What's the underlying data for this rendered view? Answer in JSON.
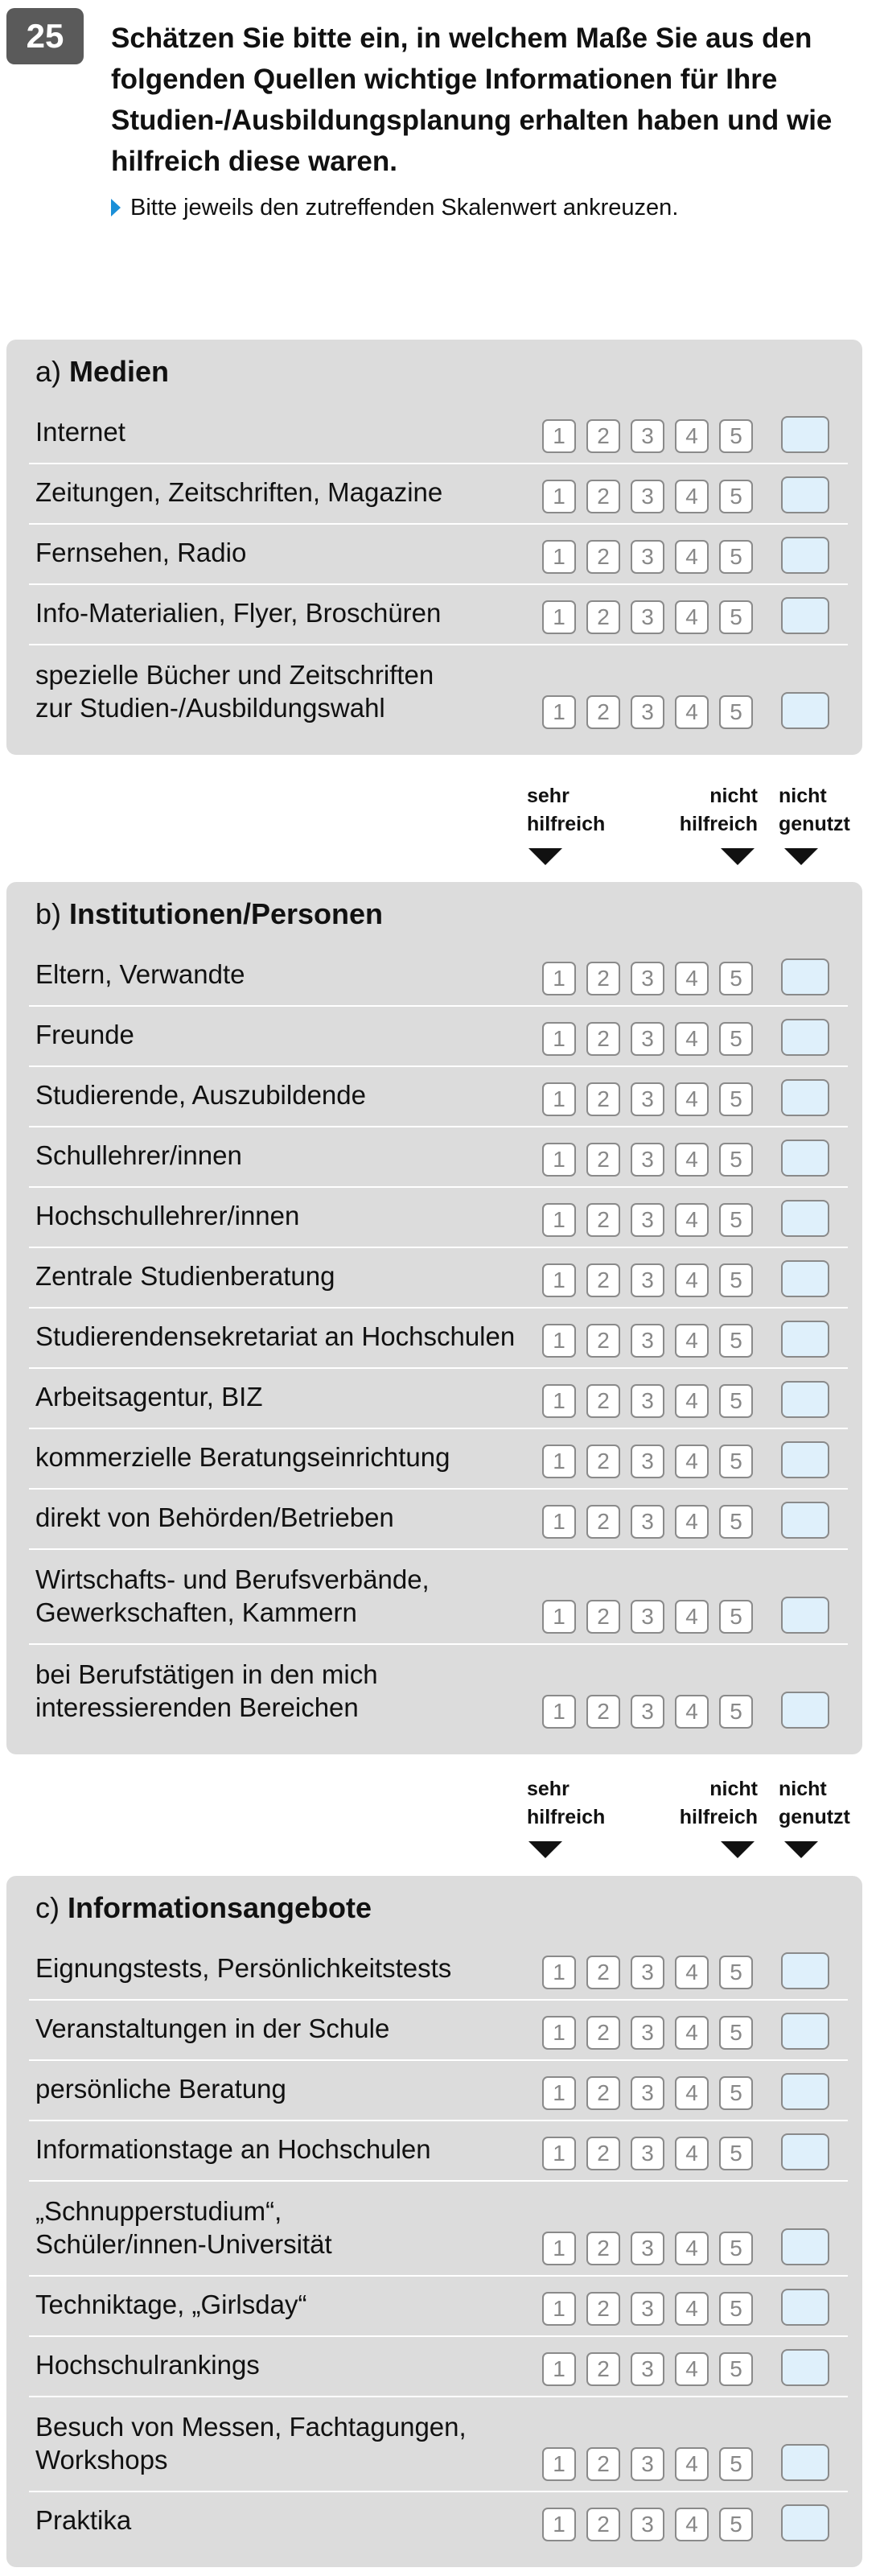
{
  "question": {
    "number": "25",
    "text": "Schätzen Sie bitte ein, in welchem Maße Sie aus den folgenden Quellen wichtige Informationen für Ihre Studien-/Ausbildungsplanung erhalten haben und wie hilfreich diese waren.",
    "instruction": "Bitte jeweils den zutreffenden Skalenwert ankreuzen."
  },
  "scale_labels": [
    "1",
    "2",
    "3",
    "4",
    "5"
  ],
  "header": {
    "left": "sehr\nhilfreich",
    "mid": "nicht\nhilfreich",
    "right": "nicht\ngenutzt"
  },
  "sections": [
    {
      "prefix": "a)",
      "title": "Medien",
      "items": [
        "Internet",
        "Zeitungen, Zeitschriften, Magazine",
        "Fernsehen, Radio",
        "Info-Materialien, Flyer, Broschüren",
        "spezielle Bücher und Zeitschriften\nzur Studien-/Ausbildungswahl"
      ]
    },
    {
      "prefix": "b)",
      "title": "Institutionen/Personen",
      "items": [
        "Eltern, Verwandte",
        "Freunde",
        "Studierende, Auszubildende",
        "Schullehrer/innen",
        "Hochschullehrer/innen",
        "Zentrale Studienberatung",
        "Studierendensekretariat an Hochschulen",
        "Arbeitsagentur, BIZ",
        "kommerzielle Beratungseinrichtung",
        "direkt von Behörden/Betrieben",
        "Wirtschafts- und Berufsverbände,\nGewerkschaften, Kammern",
        "bei Berufstätigen in den mich\ninteressierenden Bereichen"
      ]
    },
    {
      "prefix": "c)",
      "title": "Informationsangebote",
      "items": [
        "Eignungstests, Persönlichkeitstests",
        "Veranstaltungen in der Schule",
        "persönliche Beratung",
        "Informationstage an Hochschulen",
        "„Schnupperstudium“,\nSchüler/innen-Universität",
        "Techniktage, „Girlsday“",
        "Hochschulrankings",
        "Besuch von Messen, Fachtagungen,\nWorkshops",
        "Praktika"
      ]
    }
  ]
}
